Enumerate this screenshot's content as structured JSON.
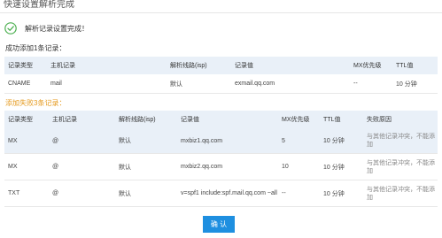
{
  "window": {
    "title": "快速设置解析完成"
  },
  "status": {
    "message": "解析记录设置完成！",
    "color": "#4caf50"
  },
  "success": {
    "header": "成功添加1条记录：",
    "columns": [
      "记录类型",
      "主机记录",
      "解析线路(isp)",
      "记录值",
      "MX优先级",
      "TTL值"
    ],
    "rows": [
      [
        "CNAME",
        "mail",
        "默认",
        "exmail.qq.com",
        "--",
        "10 分钟"
      ]
    ]
  },
  "failed": {
    "header": "添加失败3条记录：",
    "header_color": "#e59a1e",
    "columns": [
      "记录类型",
      "主机记录",
      "解析线路(isp)",
      "记录值",
      "MX优先级",
      "TTL值",
      "失败原因"
    ],
    "rows": [
      [
        "MX",
        "@",
        "默认",
        "mxbiz1.qq.com",
        "5",
        "10 分钟",
        "与其他记录冲突，不能添加"
      ],
      [
        "MX",
        "@",
        "默认",
        "mxbiz2.qq.com",
        "10",
        "10 分钟",
        "与其他记录冲突，不能添加"
      ],
      [
        "TXT",
        "@",
        "默认",
        "v=spf1 include:spf.mail.qq.com ~all",
        "--",
        "10 分钟",
        "与其他记录冲突，不能添加"
      ]
    ]
  },
  "buttons": {
    "confirm": "确 认",
    "confirm_color": "#1e8fe0"
  }
}
